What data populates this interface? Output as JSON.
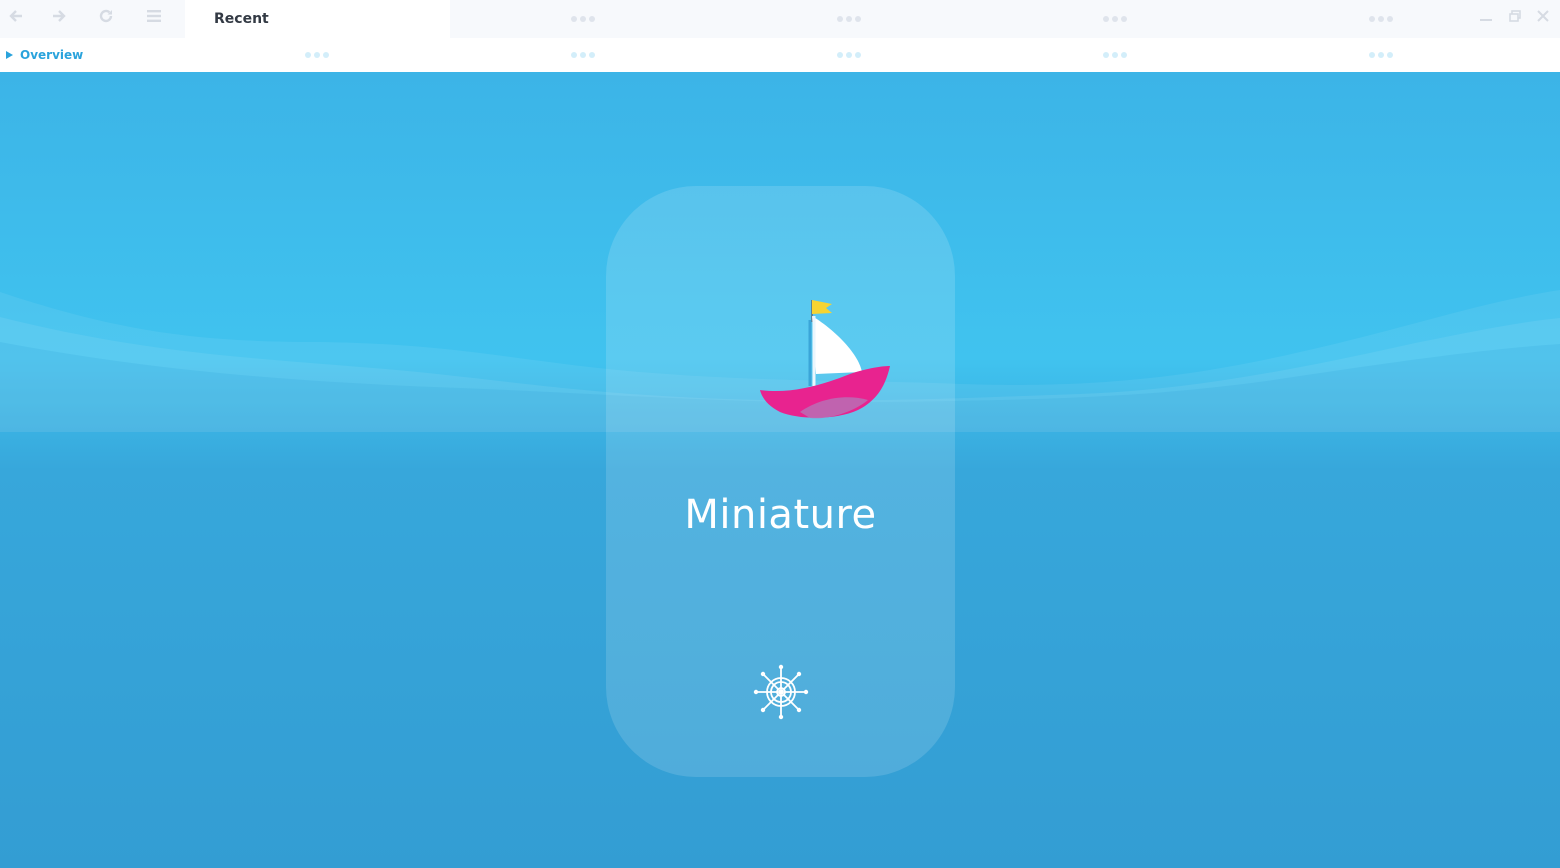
{
  "toolbar": {
    "back_icon": "arrow-left-icon",
    "forward_icon": "arrow-right-icon",
    "reload_icon": "reload-icon",
    "menu_icon": "hamburger-menu-icon"
  },
  "tabs": {
    "active_label": "Recent",
    "placeholder_icon": "ellipsis-icon"
  },
  "window": {
    "minimize_icon": "minimize-icon",
    "restore_icon": "restore-icon",
    "close_icon": "close-icon"
  },
  "breadcrumb": {
    "label": "Overview",
    "icon": "triangle-right-icon"
  },
  "main": {
    "app_name": "Miniature",
    "logo_icon": "sailboat-icon",
    "action_icon": "ship-wheel-icon"
  },
  "colors": {
    "accent": "#2aa3dc",
    "sea_top": "#3cb4e7",
    "sea_bottom": "#339dd3",
    "boat_hull": "#e8238f",
    "boat_flag": "#f6d431"
  }
}
